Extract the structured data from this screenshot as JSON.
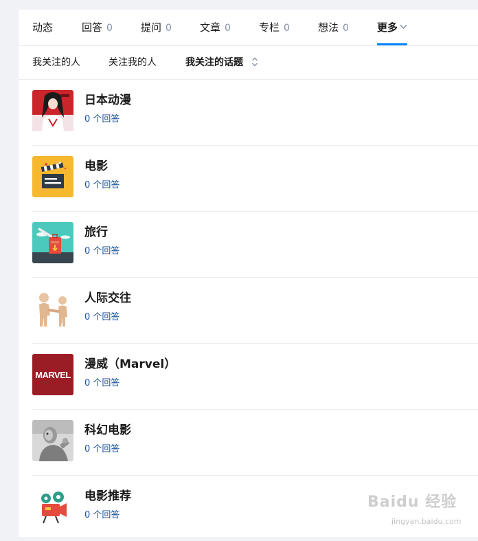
{
  "tabs": [
    {
      "label": "动态",
      "count": ""
    },
    {
      "label": "回答",
      "count": "0"
    },
    {
      "label": "提问",
      "count": "0"
    },
    {
      "label": "文章",
      "count": "0"
    },
    {
      "label": "专栏",
      "count": "0"
    },
    {
      "label": "想法",
      "count": "0"
    },
    {
      "label": "更多",
      "count": ""
    }
  ],
  "active_tab": "更多",
  "subtabs": [
    {
      "label": "我关注的人"
    },
    {
      "label": "关注我的人"
    },
    {
      "label": "我关注的话题"
    }
  ],
  "active_subtab": "我关注的话题",
  "topics": [
    {
      "title": "日本动漫",
      "answers": "0 个回答",
      "icon": "anime-girl-image"
    },
    {
      "title": "电影",
      "answers": "0 个回答",
      "icon": "clapperboard-icon"
    },
    {
      "title": "旅行",
      "answers": "0 个回答",
      "icon": "suitcase-airplane-icon"
    },
    {
      "title": "人际交往",
      "answers": "0 个回答",
      "icon": "handshake-figures-image"
    },
    {
      "title": "漫威（Marvel）",
      "answers": "0 个回答",
      "icon": "marvel-logo"
    },
    {
      "title": "科幻电影",
      "answers": "0 个回答",
      "icon": "robot-image"
    },
    {
      "title": "电影推荐",
      "answers": "0 个回答",
      "icon": "film-camera-icon"
    }
  ],
  "marvel_logo_text": "MARVEL",
  "watermark": {
    "brand": "Baidu 经验",
    "url": "jingyan.baidu.com"
  },
  "colors": {
    "accent": "#0084ff",
    "link": "#175199",
    "marvel": "#9a1d25",
    "movie_bg": "#f5b82e"
  }
}
